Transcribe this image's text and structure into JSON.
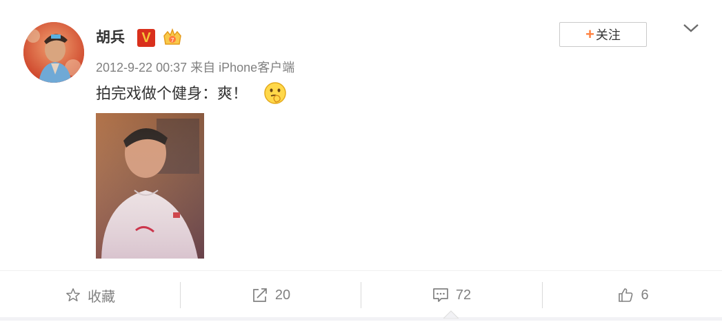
{
  "post": {
    "author_name": "胡兵",
    "verified_badge": "V",
    "timestamp": "2012-9-22 00:37",
    "source_prefix": "来自",
    "source": "iPhone客户端",
    "text": "拍完戏做个健身：爽！",
    "emoji_icon": "thinking-emoji-icon"
  },
  "header": {
    "follow_plus": "+",
    "follow_label": "关注"
  },
  "actions": {
    "favorite_label": "收藏",
    "repost_count": "20",
    "comment_count": "72",
    "like_count": "6"
  },
  "colors": {
    "accent_orange": "#ff8140",
    "verified_red": "#d9301c",
    "meta_gray": "#808080",
    "text_dark": "#333333"
  }
}
